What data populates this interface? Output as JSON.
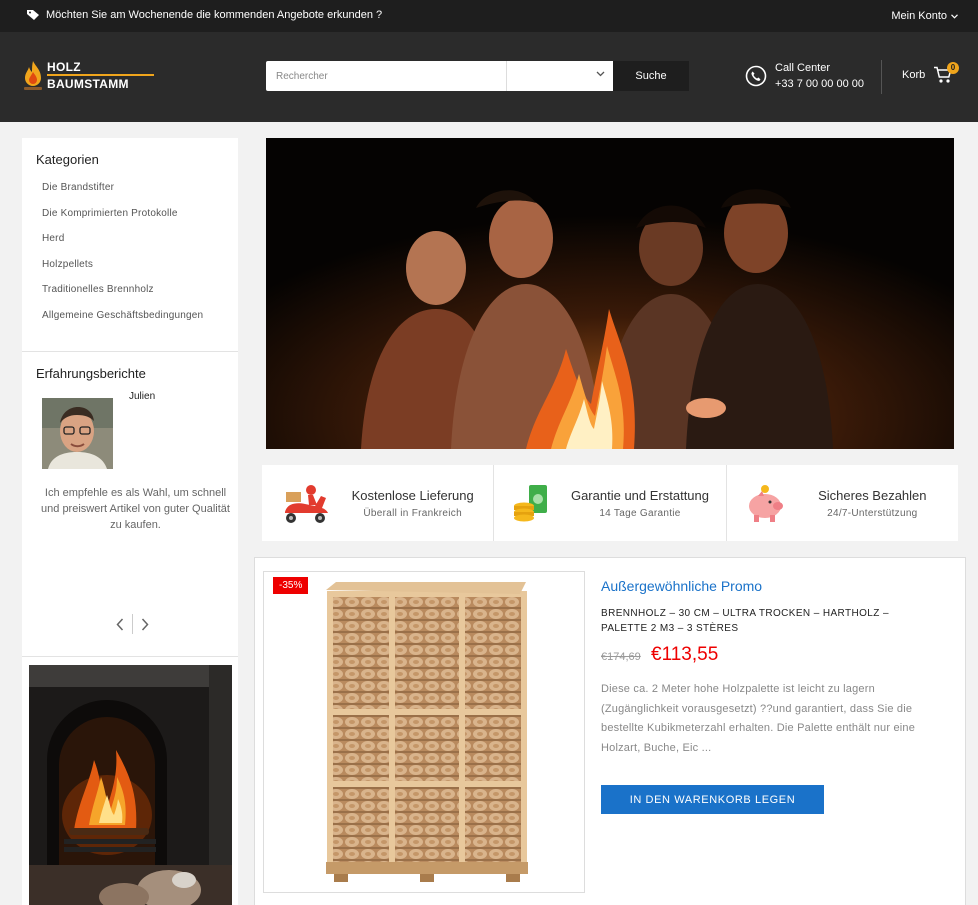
{
  "topbar": {
    "promo_text": "Möchten Sie am Wochenende die kommenden Angebote erkunden ?",
    "account_label": "Mein Konto"
  },
  "header": {
    "logo_line1": "HOLZ",
    "logo_line2": "BAUMSTAMM",
    "search_placeholder": "Rechercher",
    "search_category_value": "",
    "search_button": "Suche",
    "call_center_label": "Call Center",
    "call_center_phone": "+33 7 00 00 00 00",
    "cart_label": "Korb",
    "cart_count": "0"
  },
  "sidebar": {
    "categories_title": "Kategorien",
    "categories": [
      "Die Brandstifter",
      "Die Komprimierten Protokolle",
      "Herd",
      "Holzpellets",
      "Traditionelles Brennholz",
      "Allgemeine Geschäftsbedingungen"
    ],
    "testimonials_title": "Erfahrungsberichte",
    "testimonial": {
      "name": "Julien",
      "text": "Ich empfehle es als Wahl, um schnell und preiswert Artikel von guter Qualität zu kaufen."
    }
  },
  "features": [
    {
      "title": "Kostenlose Lieferung",
      "subtitle": "Überall in Frankreich",
      "icon": "delivery-scooter-icon"
    },
    {
      "title": "Garantie und Erstattung",
      "subtitle": "14 Tage Garantie",
      "icon": "money-coins-icon"
    },
    {
      "title": "Sicheres Bezahlen",
      "subtitle": "24/7-Unterstützung",
      "icon": "piggy-bank-icon"
    }
  ],
  "product": {
    "badge": "-35%",
    "promo_title": "Außergewöhnliche Promo",
    "name": "BRENNHOLZ – 30 CM – ULTRA TROCKEN – HARTHOLZ – PALETTE 2 M3 – 3 STÈRES",
    "old_price": "€174,69",
    "new_price": "€113,55",
    "description": "Diese ca. 2 Meter hohe Holzpalette ist leicht zu lagern (Zugänglichkeit vorausgesetzt) ??und garantiert, dass Sie die bestellte Kubikmeterzahl erhalten. Die Palette enthält nur eine Holzart, Buche, Eic ...",
    "cta": "IN DEN WARENKORB LEGEN"
  },
  "colors": {
    "accent": "#f0a51c",
    "link_blue": "#1a72c9",
    "price_red": "#e00000",
    "dark": "#1e1e1e"
  }
}
